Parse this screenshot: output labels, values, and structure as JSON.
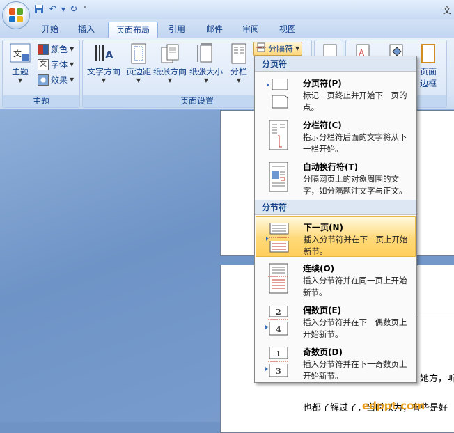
{
  "window": {
    "title_fragment": "文"
  },
  "tabs": [
    "开始",
    "插入",
    "页面布局",
    "引用",
    "邮件",
    "审阅",
    "视图"
  ],
  "active_tab": "页面布局",
  "ribbon": {
    "theme_group": {
      "label": "主题",
      "theme_button": "主题",
      "colors": "颜色",
      "fonts": "字体",
      "effects": "效果"
    },
    "page_setup_group": {
      "label": "页面设置",
      "text_direction": "文字方向",
      "margins": "页边距",
      "orientation": "纸张方向",
      "size": "纸张大小",
      "columns": "分栏",
      "breaks": "分隔符"
    },
    "page_border_line1": "页面",
    "page_border_line2": "边框"
  },
  "menu": {
    "section_page_breaks": "分页符",
    "section_section_breaks": "分节符",
    "items": [
      {
        "title": "分页符(P)",
        "desc": "标记一页终止并开始下一页的点。"
      },
      {
        "title": "分栏符(C)",
        "desc": "指示分栏符后面的文字将从下一栏开始。"
      },
      {
        "title": "自动换行符(T)",
        "desc": "分隔网页上的对象周围的文字，如分隔题注文字与正文。"
      },
      {
        "title": "下一页(N)",
        "desc": "插入分节符并在下一页上开始新节。"
      },
      {
        "title": "连续(O)",
        "desc": "插入分节符并在同一页上开始新节。"
      },
      {
        "title": "偶数页(E)",
        "desc": "插入分节符并在下一偶数页上开始新节。"
      },
      {
        "title": "奇数页(D)",
        "desc": "插入分节符并在下一奇数页上开始新节。"
      }
    ],
    "highlighted_index": 3
  },
  "document": {
    "line1": "她方，听过",
    "line2": "也都了解过了，当时以为，有些是好"
  },
  "watermark": "edppt.com"
}
